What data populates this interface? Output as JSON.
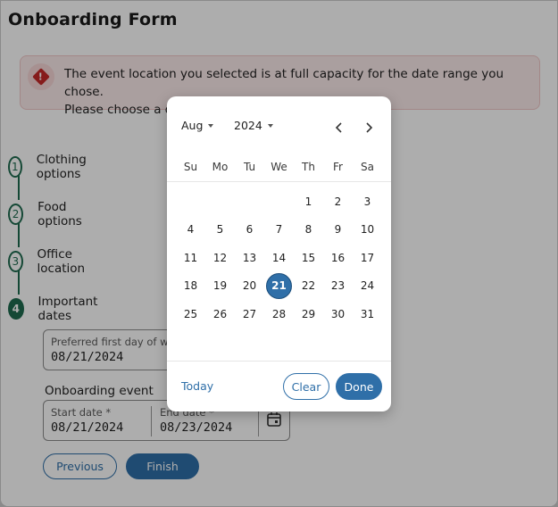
{
  "page": {
    "title": "Onboarding Form"
  },
  "alert": {
    "icon": "error-diamond-icon",
    "line1": "The event location you selected is at full capacity for the date range you chose.",
    "line2": "Please choose a different location or a different date.",
    "icon_glyph": "!"
  },
  "stepper": {
    "steps": [
      {
        "number": "1",
        "label": "Clothing options",
        "active": false
      },
      {
        "number": "2",
        "label": "Food options",
        "active": false
      },
      {
        "number": "3",
        "label": "Office location",
        "active": false
      },
      {
        "number": "4",
        "label": "Important dates",
        "active": true
      }
    ]
  },
  "form": {
    "first_day": {
      "label": "Preferred first day of work",
      "value": "08/21/2024"
    },
    "event_section": "Onboarding event",
    "start_date": {
      "label": "Start date *",
      "value": "08/21/2024"
    },
    "end_date": {
      "label": "End date *",
      "value": "08/23/2024"
    },
    "previous_label": "Previous",
    "finish_label": "Finish"
  },
  "datepicker": {
    "month": "Aug",
    "year": "2024",
    "prev_glyph": "‹",
    "next_glyph": "›",
    "weekdays": [
      "Su",
      "Mo",
      "Tu",
      "We",
      "Th",
      "Fr",
      "Sa"
    ],
    "weeks": [
      [
        "",
        "",
        "",
        "",
        "1",
        "2",
        "3"
      ],
      [
        "4",
        "5",
        "6",
        "7",
        "8",
        "9",
        "10"
      ],
      [
        "11",
        "12",
        "13",
        "14",
        "15",
        "16",
        "17"
      ],
      [
        "18",
        "19",
        "20",
        "21",
        "22",
        "23",
        "24"
      ],
      [
        "25",
        "26",
        "27",
        "28",
        "29",
        "30",
        "31"
      ]
    ],
    "selected_day": "21",
    "today_label": "Today",
    "clear_label": "Clear",
    "done_label": "Done"
  },
  "colors": {
    "primary": "#2f6fa8",
    "step_green": "#1e6b4f",
    "error_red": "#c62828",
    "alert_bg": "#fbeaea"
  }
}
